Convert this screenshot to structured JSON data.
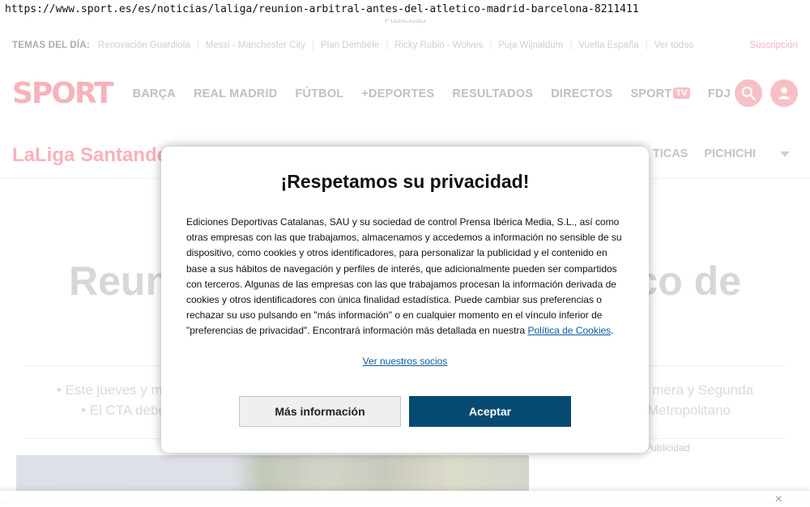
{
  "browser": {
    "url": "https://www.sport.es/es/noticias/laliga/reunion-arbitral-antes-del-atletico-madrid-barcelona-8211411"
  },
  "ads": {
    "top_label": "Publicidad",
    "side_label": "Publicidad"
  },
  "topics": {
    "label": "TEMAS DEL DÍA:",
    "items": [
      "Renovación Guardiola",
      "Messi - Manchester City",
      "Plan Dembéle",
      "Ricky Rubio - Wolves",
      "Puja Wijnaldum",
      "Vuelta España",
      "Ver todos"
    ],
    "subscription": "Suscripción"
  },
  "nav": {
    "logo": "SPORT",
    "items": [
      "BARÇA",
      "REAL MADRID",
      "FÚTBOL",
      "+DEPORTES",
      "RESULTADOS",
      "DIRECTOS"
    ],
    "sport_tv": {
      "label": "SPORT",
      "badge": "TV"
    },
    "fdj": "FDJ",
    "search_icon": "search-icon",
    "user_icon": "user-icon",
    "accent_color": "#e30613"
  },
  "subnav": {
    "title": "LaLiga Santander",
    "items": [
      "TICAS",
      "PICHICHI"
    ]
  },
  "article": {
    "headline_left": "Reun",
    "headline_right": "co de",
    "bullet1_left": "• Este jueves y m",
    "bullet1_right": "mera y Segunda",
    "bullet2_left": "• El CTA debe",
    "bullet2_right": "Metropolitano"
  },
  "consent": {
    "title": "¡Respetamos su privacidad!",
    "body": "Ediciones Deportivas Catalanas, SAU y su sociedad de control Prensa Ibérica Media, S.L., así como otras empresas con las que trabajamos, almacenamos y accedemos a información no sensible de su dispositivo, como cookies y otros identificadores, para personalizar la publicidad y el contenido en base a sus hábitos de navegación y perfiles de interés, que adicionalmente pueden ser compartidos con terceros. Algunas de las empresas con las que trabajamos procesan la información derivada de cookies y otros identificadores con única finalidad estadística. Puede cambiar sus preferencias o rechazar su uso pulsando en \"más información\" o en cualquier momento en el vínculo inferior de \"preferencias de privacidad\". Encontrará información más detallada en nuestra",
    "cookie_link": "Política de Cookies",
    "period": ".",
    "partners_link": "Ver nuestros socios",
    "more_button": "Más información",
    "accept_button": "Aceptar",
    "accept_color": "#064a72"
  },
  "footer": {
    "close_icon": "close-icon",
    "close_glyph": "×"
  }
}
